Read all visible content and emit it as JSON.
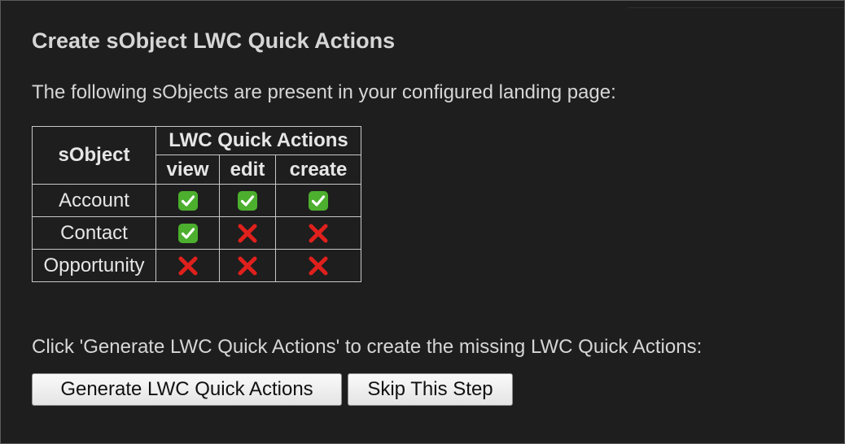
{
  "title": "Create sObject LWC Quick Actions",
  "intro": "The following sObjects are present in your configured landing page:",
  "table": {
    "col_sobject": "sObject",
    "group_header": "LWC Quick Actions",
    "actions": [
      "view",
      "edit",
      "create"
    ],
    "rows": [
      {
        "name": "Account",
        "view": "check-icon",
        "edit": "check-icon",
        "create": "check-icon"
      },
      {
        "name": "Contact",
        "view": "check-icon",
        "edit": "cross-icon",
        "create": "cross-icon"
      },
      {
        "name": "Opportunity",
        "view": "cross-icon",
        "edit": "cross-icon",
        "create": "cross-icon"
      }
    ]
  },
  "prompt": "Click 'Generate LWC Quick Actions' to create the missing LWC Quick Actions:",
  "buttons": {
    "generate": "Generate LWC Quick Actions",
    "skip": "Skip This Step"
  },
  "colors": {
    "background": "#1e1e1e",
    "text": "#d6d6d6",
    "check": "#4caf2e",
    "cross": "#e0201c"
  }
}
